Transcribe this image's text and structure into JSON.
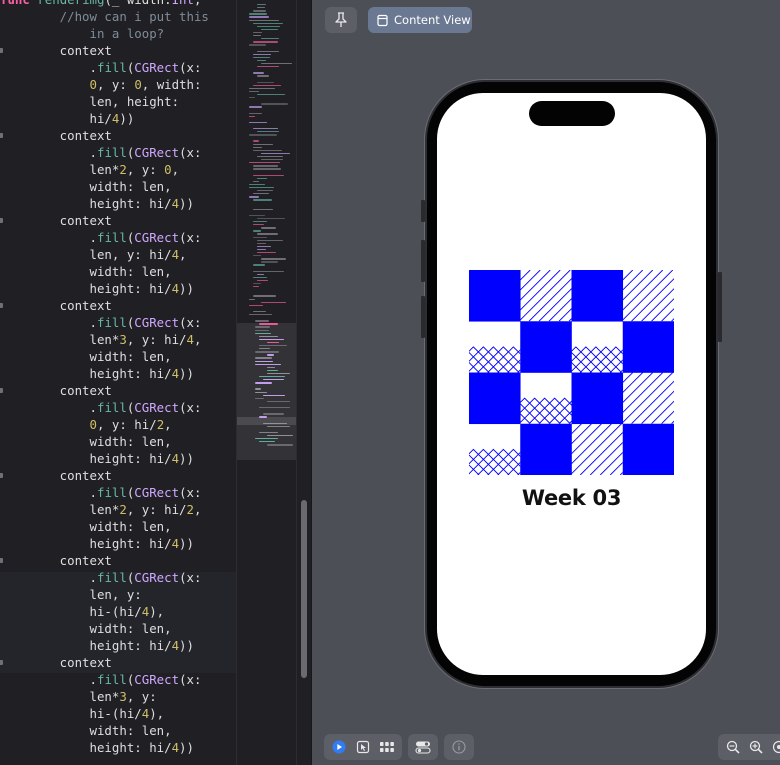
{
  "editor": {
    "lines": [
      [
        [
          "kw",
          "func "
        ],
        [
          "fn",
          "renderimg"
        ],
        [
          "pl",
          "(_ width:"
        ],
        [
          "ty",
          "Int"
        ],
        [
          "pl",
          ","
        ]
      ],
      [
        [
          "cm",
          "        //how can i put this"
        ]
      ],
      [
        [
          "cm",
          "            in a loop?"
        ]
      ],
      [
        [
          "pl",
          "        context"
        ]
      ],
      [
        [
          "pl",
          "            ."
        ],
        [
          "fn",
          "fill"
        ],
        [
          "pl",
          "("
        ],
        [
          "ty",
          "CGRect"
        ],
        [
          "pl",
          "(x:"
        ]
      ],
      [
        [
          "pl",
          "            "
        ],
        [
          "nu",
          "0"
        ],
        [
          "pl",
          ", y: "
        ],
        [
          "nu",
          "0"
        ],
        [
          "pl",
          ", width:"
        ]
      ],
      [
        [
          "pl",
          "            len, height:"
        ]
      ],
      [
        [
          "pl",
          "            hi/"
        ],
        [
          "nu",
          "4"
        ],
        [
          "pl",
          "))"
        ]
      ],
      [
        [
          "pl",
          "        context"
        ]
      ],
      [
        [
          "pl",
          "            ."
        ],
        [
          "fn",
          "fill"
        ],
        [
          "pl",
          "("
        ],
        [
          "ty",
          "CGRect"
        ],
        [
          "pl",
          "(x:"
        ]
      ],
      [
        [
          "pl",
          "            len*"
        ],
        [
          "nu",
          "2"
        ],
        [
          "pl",
          ", y: "
        ],
        [
          "nu",
          "0"
        ],
        [
          "pl",
          ","
        ]
      ],
      [
        [
          "pl",
          "            width: len,"
        ]
      ],
      [
        [
          "pl",
          "            height: hi/"
        ],
        [
          "nu",
          "4"
        ],
        [
          "pl",
          "))"
        ]
      ],
      [
        [
          "pl",
          "        context"
        ]
      ],
      [
        [
          "pl",
          "            ."
        ],
        [
          "fn",
          "fill"
        ],
        [
          "pl",
          "("
        ],
        [
          "ty",
          "CGRect"
        ],
        [
          "pl",
          "(x:"
        ]
      ],
      [
        [
          "pl",
          "            len, y: hi/"
        ],
        [
          "nu",
          "4"
        ],
        [
          "pl",
          ","
        ]
      ],
      [
        [
          "pl",
          "            width: len,"
        ]
      ],
      [
        [
          "pl",
          "            height: hi/"
        ],
        [
          "nu",
          "4"
        ],
        [
          "pl",
          "))"
        ]
      ],
      [
        [
          "pl",
          "        context"
        ]
      ],
      [
        [
          "pl",
          "            ."
        ],
        [
          "fn",
          "fill"
        ],
        [
          "pl",
          "("
        ],
        [
          "ty",
          "CGRect"
        ],
        [
          "pl",
          "(x:"
        ]
      ],
      [
        [
          "pl",
          "            len*"
        ],
        [
          "nu",
          "3"
        ],
        [
          "pl",
          ", y: hi/"
        ],
        [
          "nu",
          "4"
        ],
        [
          "pl",
          ","
        ]
      ],
      [
        [
          "pl",
          "            width: len,"
        ]
      ],
      [
        [
          "pl",
          "            height: hi/"
        ],
        [
          "nu",
          "4"
        ],
        [
          "pl",
          "))"
        ]
      ],
      [
        [
          "pl",
          "        context"
        ]
      ],
      [
        [
          "pl",
          "            ."
        ],
        [
          "fn",
          "fill"
        ],
        [
          "pl",
          "("
        ],
        [
          "ty",
          "CGRect"
        ],
        [
          "pl",
          "(x:"
        ]
      ],
      [
        [
          "pl",
          "            "
        ],
        [
          "nu",
          "0"
        ],
        [
          "pl",
          ", y: hi/"
        ],
        [
          "nu",
          "2"
        ],
        [
          "pl",
          ","
        ]
      ],
      [
        [
          "pl",
          "            width: len,"
        ]
      ],
      [
        [
          "pl",
          "            height: hi/"
        ],
        [
          "nu",
          "4"
        ],
        [
          "pl",
          "))"
        ]
      ],
      [
        [
          "pl",
          "        context"
        ]
      ],
      [
        [
          "pl",
          "            ."
        ],
        [
          "fn",
          "fill"
        ],
        [
          "pl",
          "("
        ],
        [
          "ty",
          "CGRect"
        ],
        [
          "pl",
          "(x:"
        ]
      ],
      [
        [
          "pl",
          "            len*"
        ],
        [
          "nu",
          "2"
        ],
        [
          "pl",
          ", y: hi/"
        ],
        [
          "nu",
          "2"
        ],
        [
          "pl",
          ","
        ]
      ],
      [
        [
          "pl",
          "            width: len,"
        ]
      ],
      [
        [
          "pl",
          "            height: hi/"
        ],
        [
          "nu",
          "4"
        ],
        [
          "pl",
          "))"
        ]
      ],
      [
        [
          "pl",
          "        context"
        ]
      ],
      [
        [
          "pl",
          "            ."
        ],
        [
          "fn",
          "fill"
        ],
        [
          "pl",
          "("
        ],
        [
          "ty",
          "CGRect"
        ],
        [
          "pl",
          "(x:"
        ]
      ],
      [
        [
          "pl",
          "            len, y:"
        ]
      ],
      [
        [
          "pl",
          "            hi-(hi/"
        ],
        [
          "nu",
          "4"
        ],
        [
          "pl",
          "),"
        ]
      ],
      [
        [
          "pl",
          "            width: len,"
        ]
      ],
      [
        [
          "pl",
          "            height: hi/"
        ],
        [
          "nu",
          "4"
        ],
        [
          "pl",
          "))"
        ]
      ],
      [
        [
          "pl",
          "        context"
        ]
      ],
      [
        [
          "pl",
          "            ."
        ],
        [
          "fn",
          "fill"
        ],
        [
          "pl",
          "("
        ],
        [
          "ty",
          "CGRect"
        ],
        [
          "pl",
          "(x:"
        ]
      ],
      [
        [
          "pl",
          "            len*"
        ],
        [
          "nu",
          "3"
        ],
        [
          "pl",
          ", y:"
        ]
      ],
      [
        [
          "pl",
          "            hi-(hi/"
        ],
        [
          "nu",
          "4"
        ],
        [
          "pl",
          "),"
        ]
      ],
      [
        [
          "pl",
          "            width: len,"
        ]
      ],
      [
        [
          "pl",
          "            height: hi/"
        ],
        [
          "nu",
          "4"
        ],
        [
          "pl",
          "))"
        ]
      ]
    ],
    "markers": [
      3,
      8,
      13,
      18,
      23,
      28,
      33,
      39
    ]
  },
  "colors": {
    "keyword": "#fc5fa3",
    "function": "#67b7a4",
    "type": "#d0a8ff",
    "plain": "#dfdfe0",
    "number": "#d0bf69",
    "comment": "#7f8c98",
    "tile_blue": "#0000ff"
  },
  "canvas": {
    "pin_icon": "pin-icon",
    "content_view_label": "Content View"
  },
  "preview": {
    "title": "Week 03",
    "grid": [
      [
        "solid",
        "diag",
        "solid",
        "diag"
      ],
      [
        "zig",
        "solid",
        "zig",
        "solid"
      ],
      [
        "solid",
        "zig",
        "solid",
        "diag"
      ],
      [
        "zig",
        "solid",
        "diag",
        "solid"
      ]
    ]
  },
  "toolbar": {
    "icons": [
      "live-preview-icon",
      "selectable-icon",
      "variants-icon",
      "device-settings-icon",
      "info-icon"
    ],
    "zoom_icons": [
      "zoom-out-icon",
      "zoom-in-icon",
      "zoom-fit-icon"
    ]
  }
}
